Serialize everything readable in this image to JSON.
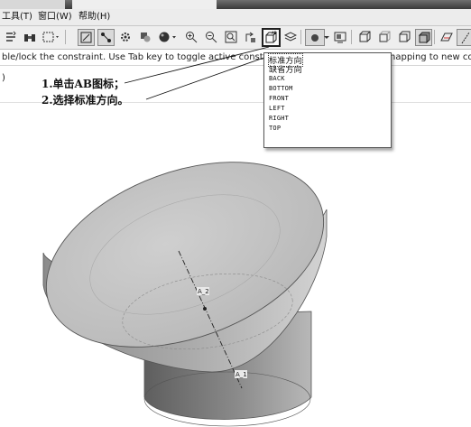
{
  "menu": {
    "tools": "工具(T)",
    "window": "窗口(W)",
    "help": "帮助(H)"
  },
  "toolbar": {
    "ab_icon_label": "AB",
    "icons": [
      "regenerate-icon",
      "binoculars-icon",
      "select-box-icon",
      "sketch-icon",
      "connect-icon",
      "settings-gear-icon",
      "sphere-icon",
      "zoom-in-icon",
      "zoom-out-icon",
      "zoom-fit-icon",
      "saved-view-icon",
      "layer-icon",
      "shading-icon",
      "display-icon",
      "wireframe-icon",
      "hidden-line-icon",
      "no-hidden-icon",
      "shaded-icon",
      "datum-plane-icon",
      "datum-axis-icon"
    ]
  },
  "status": {
    "left": "ble/lock the constraint. Use Tab key to toggle active constraint.",
    "right": "napping to new cor"
  },
  "field_row": {
    "paren": ")"
  },
  "callouts": {
    "step1": "1.单击AB图标；",
    "step2": "2.选择标准方向。"
  },
  "view_menu": {
    "items": [
      {
        "label": "标准方向",
        "selected": true
      },
      {
        "label": "缺省方向",
        "selected": false
      },
      {
        "label": "BACK",
        "selected": false
      },
      {
        "label": "BOTTOM",
        "selected": false
      },
      {
        "label": "FRONT",
        "selected": false
      },
      {
        "label": "LEFT",
        "selected": false
      },
      {
        "label": "RIGHT",
        "selected": false
      },
      {
        "label": "TOP",
        "selected": false
      }
    ]
  },
  "model": {
    "axis_label_top": "A_2",
    "axis_label_bottom": "A_1",
    "colors": {
      "top_face": "#c4c4c4",
      "side_light": "#c8c8c8",
      "side_dark": "#6f6f6f",
      "edge": "#555555"
    }
  }
}
